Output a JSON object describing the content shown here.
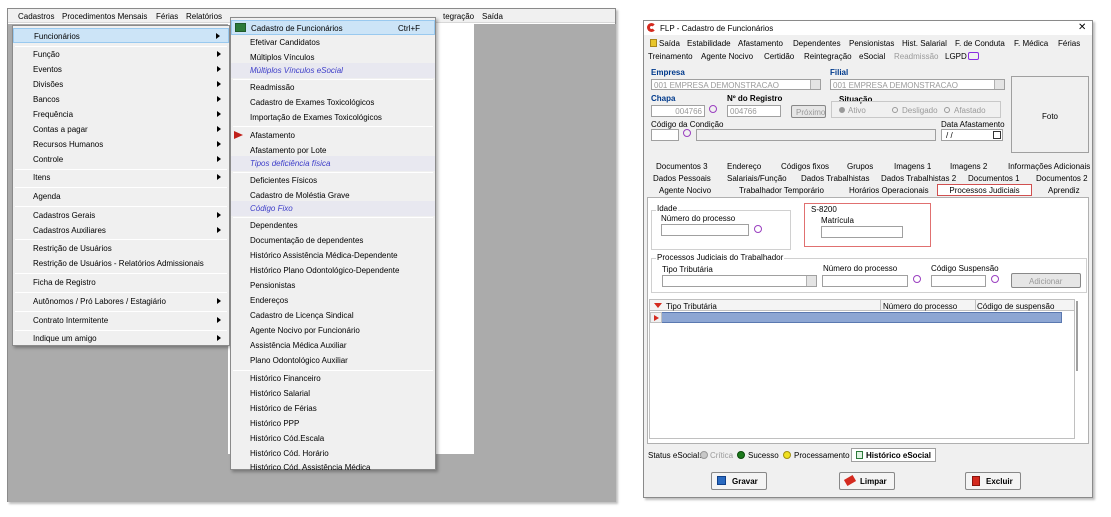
{
  "left_app": {
    "menubar": [
      "Cadastros",
      "Procedimentos Mensais",
      "Férias",
      "Relatórios",
      "tegração",
      "Saída"
    ],
    "main_menu": [
      "Funcionários",
      "Função",
      "Eventos",
      "Divisões",
      "Bancos",
      "Frequência",
      "Contas a pagar",
      "Recursos Humanos",
      "Controle",
      "Itens",
      "Agenda",
      "Cadastros Gerais",
      "Cadastros Auxiliares",
      "Restrição de Usuários",
      "Restrição de Usuários - Relatórios Admissionais",
      "Ficha de Registro",
      "Autônomos / Pró Labores / Estagiário",
      "Contrato Intermitente",
      "Indique um amigo"
    ],
    "submenu": [
      "Cadastro de Funcionários",
      "Efetivar Candidatos",
      "Múltiplos Vínculos",
      "Múltiplos Vínculos eSocial",
      "Readmissão",
      "Cadastro de Exames Toxicológicos",
      "Importação de Exames Toxicológicos",
      "Afastamento",
      "Afastamento por Lote",
      "Tipos deficiência física",
      "Deficientes Físicos",
      "Cadastro de Moléstia Grave",
      "Código Fixo",
      "Dependentes",
      "Documentação de dependentes",
      "Histórico Assistência Médica-Dependente",
      "Histórico Plano Odontológico-Dependente",
      "Pensionistas",
      "Endereços",
      "Cadastro de Licença Sindical",
      "Agente Nocivo por Funcionário",
      "Assistência Médica Auxiliar",
      "Plano Odontológico Auxiliar",
      "Histórico Financeiro",
      "Histórico Salarial",
      "Histórico de Férias",
      "Histórico PPP",
      "Histórico Cód.Escala",
      "Histórico Cód. Horário",
      "Histórico Cód. Assistência Médica"
    ],
    "shortcut": "Ctrl+F"
  },
  "right_app": {
    "title": "FLP - Cadastro de Funcionários",
    "close": "✕",
    "menu_row1": [
      "Saída",
      "Estabilidade",
      "Afastamento",
      "Dependentes",
      "Pensionistas",
      "Hist. Salarial",
      "F. de Conduta",
      "F. Médica",
      "Férias"
    ],
    "menu_row2": [
      "Treinamento",
      "Agente Nocivo",
      "Certidão",
      "Reintegração",
      "eSocial",
      "Readmissão",
      "LGPD"
    ],
    "empresa_label": "Empresa",
    "empresa_value": "001 EMPRESA DEMONSTRACAO",
    "filial_label": "Filial",
    "filial_value": "001 EMPRESA DEMONSTRACAO",
    "chapa_label": "Chapa",
    "chapa_value": "004766",
    "registro_label": "Nº do Registro",
    "registro_value": "004766",
    "proximo": "Próximo",
    "situacao_label": "Situação",
    "situacao_options": [
      "Ativo",
      "Desligado",
      "Afastado"
    ],
    "condicao_label": "Código da Condição",
    "data_afast_label": "Data Afastamento",
    "data_afast_value": " / /",
    "foto": "Foto",
    "tabs_row1": [
      "Documentos 3",
      "Endereço",
      "Códigos fixos",
      "Grupos",
      "Imagens 1",
      "Imagens 2",
      "Informações Adicionais"
    ],
    "tabs_row2": [
      "Dados Pessoais",
      "Salariais/Função",
      "Dados Trabalhistas",
      "Dados Trabalhistas 2",
      "Documentos 1",
      "Documentos 2"
    ],
    "tabs_row3": [
      "Agente Nocivo",
      "Trabalhador Temporário",
      "Horários Operacionais",
      "Processos Judiciais",
      "Aprendiz"
    ],
    "idade_label": "Idade",
    "num_processo_label": "Número do processo",
    "s8200_label": "S-8200",
    "matricula_label": "Matrícula",
    "processos_group": "Processos Judiciais do Trabalhador",
    "tipo_trib_label": "Tipo Tributária",
    "num_proc2_label": "Número do processo",
    "cod_susp_label": "Código Suspensão",
    "adicionar": "Adicionar",
    "grid_headers": [
      "Tipo Tributária",
      "Número do processo",
      "Código de suspensão"
    ],
    "status_label": "Status eSocial:",
    "status_items": [
      "Crítica",
      "Sucesso",
      "Processamento"
    ],
    "historico": "Histórico eSocial",
    "btn_gravar": "Gravar",
    "btn_limpar": "Limpar",
    "btn_excluir": "Excluir"
  }
}
